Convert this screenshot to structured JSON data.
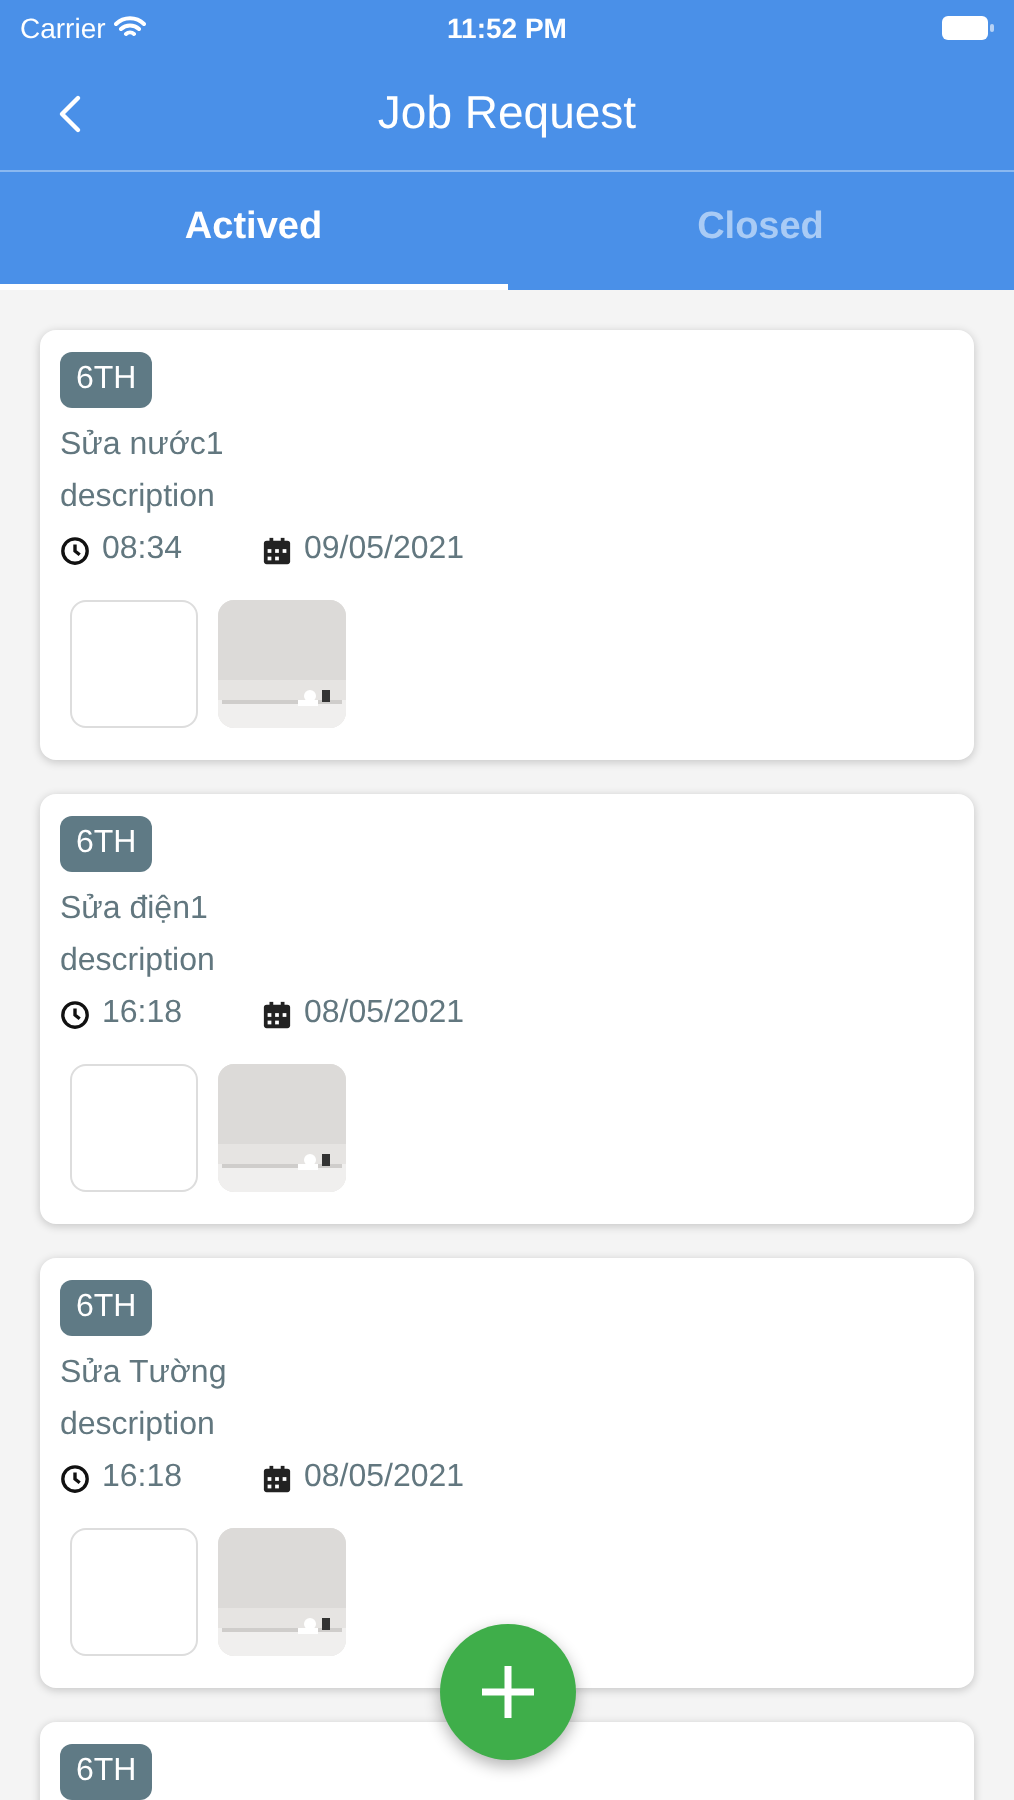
{
  "status_bar": {
    "carrier": "Carrier",
    "time": "11:52 PM"
  },
  "header": {
    "title": "Job Request"
  },
  "tabs": [
    {
      "label": "Actived",
      "selected": true
    },
    {
      "label": "Closed",
      "selected": false
    }
  ],
  "jobs": [
    {
      "tag": "6TH",
      "title": "Sửa nước1",
      "description": "description",
      "time": "08:34",
      "date": "09/05/2021",
      "attachments": [
        {
          "kind": "blank"
        },
        {
          "kind": "picture"
        }
      ]
    },
    {
      "tag": "6TH",
      "title": "Sửa điện1",
      "description": "description",
      "time": "16:18",
      "date": "08/05/2021",
      "attachments": [
        {
          "kind": "blank"
        },
        {
          "kind": "picture"
        }
      ]
    },
    {
      "tag": "6TH",
      "title": "Sửa Tường",
      "description": "description",
      "time": "16:18",
      "date": "08/05/2021",
      "attachments": [
        {
          "kind": "blank"
        },
        {
          "kind": "picture"
        }
      ]
    },
    {
      "tag": "6TH"
    }
  ]
}
